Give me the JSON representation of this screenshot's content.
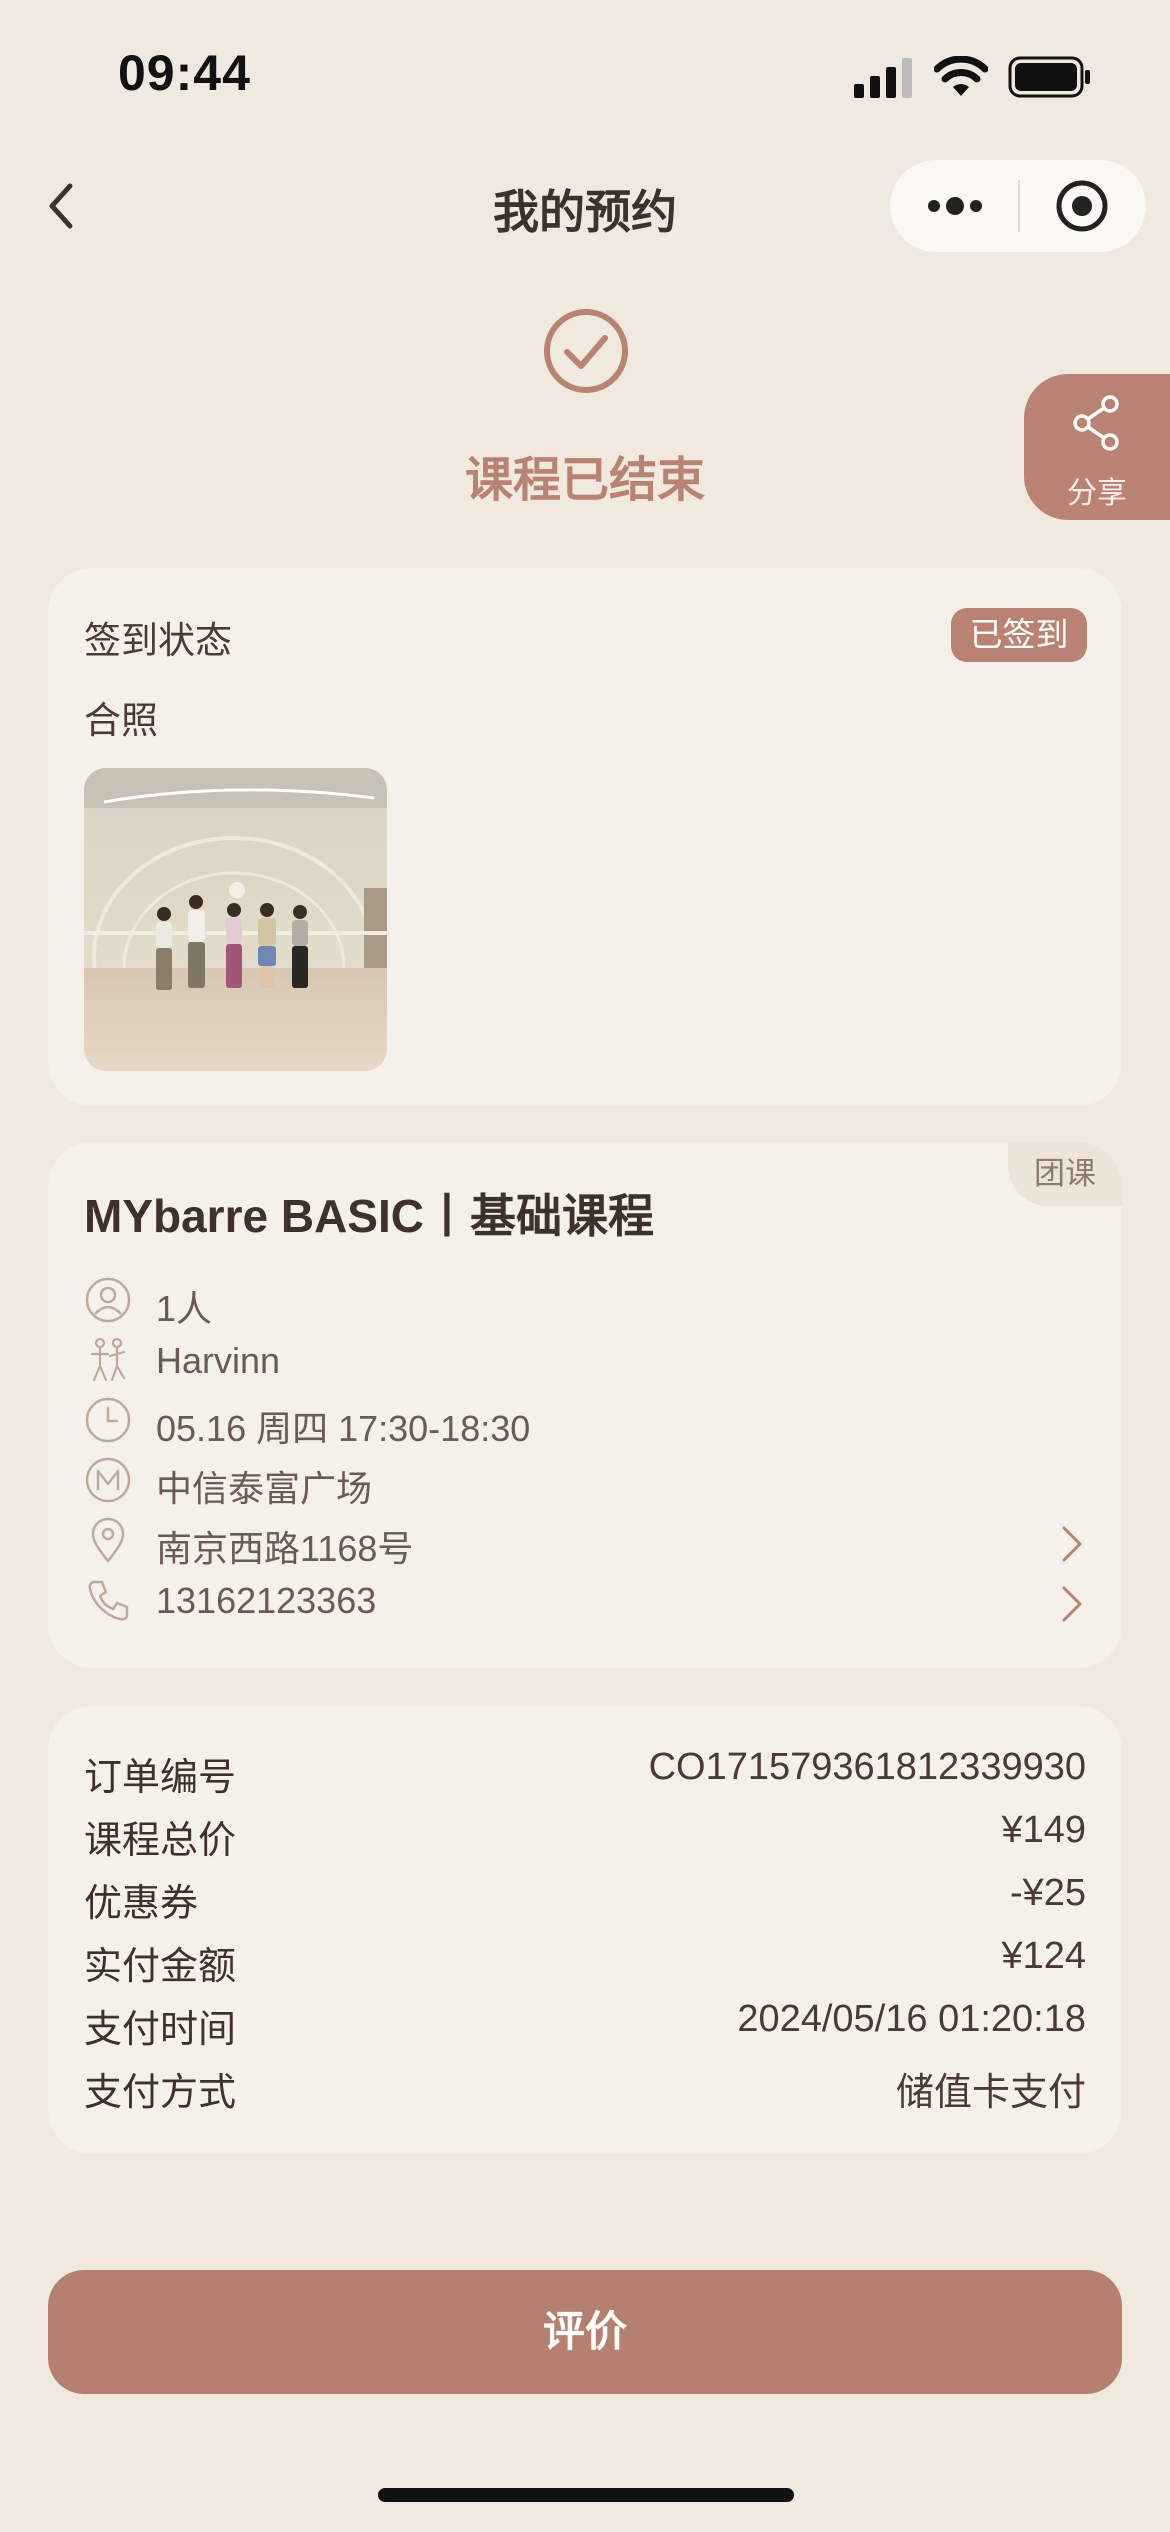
{
  "status_bar": {
    "time": "09:44"
  },
  "nav": {
    "title": "我的预约"
  },
  "status": {
    "text": "课程已结束"
  },
  "share": {
    "label": "分享"
  },
  "checkin": {
    "title": "签到状态",
    "badge": "已签到",
    "photo_label": "合照"
  },
  "course": {
    "tag": "团课",
    "title": "MYbarre BASIC丨基础课程",
    "people": "1人",
    "coach": "Harvinn",
    "time": "05.16 周四 17:30-18:30",
    "venue": "中信泰富广场",
    "address": "南京西路1168号",
    "phone": "13162123363"
  },
  "order": {
    "rows": [
      {
        "label": "订单编号",
        "value": "CO171579361812339930"
      },
      {
        "label": "课程总价",
        "value": "¥149"
      },
      {
        "label": "优惠券",
        "value": "-¥25"
      },
      {
        "label": "实付金额",
        "value": "¥124"
      },
      {
        "label": "支付时间",
        "value": "2024/05/16 01:20:18"
      },
      {
        "label": "支付方式",
        "value": "储值卡支付"
      }
    ]
  },
  "actions": {
    "review_label": "评价"
  },
  "colors": {
    "accent": "#b98272",
    "background": "#efe9df",
    "card": "#f5f1ea"
  }
}
